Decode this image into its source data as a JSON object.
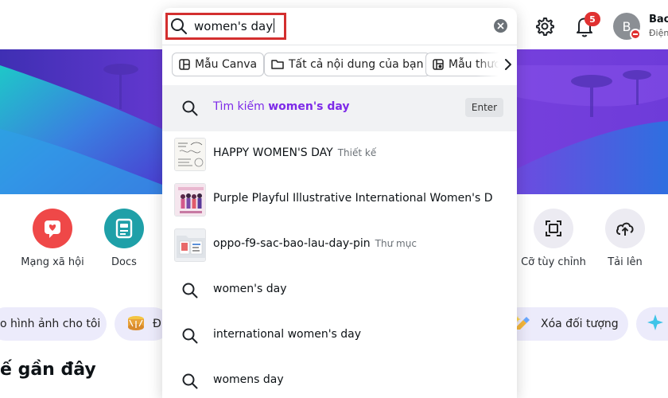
{
  "search": {
    "query": "women's day",
    "filters": [
      {
        "label": "Mẫu Canva",
        "icon": "template-icon"
      },
      {
        "label": "Tất cả nội dung của bạn",
        "icon": "folder-icon"
      },
      {
        "label": "Mẫu thươn",
        "icon": "brand-template-icon"
      }
    ],
    "enter_prefix": "Tìm kiếm",
    "enter_query": "women's day",
    "enter_key": "Enter",
    "results": [
      {
        "title": "HAPPY WOMEN'S DAY",
        "type": "Thiết kế"
      },
      {
        "title": "Purple Playful Illustrative International Women's D...",
        "type": ""
      },
      {
        "title": "oppo-f9-sac-bao-lau-day-pin",
        "type": "Thư mục"
      }
    ],
    "suggestions": [
      "women's day",
      "international women's day",
      "womens day"
    ]
  },
  "header": {
    "notification_count": "5",
    "avatar_initial": "B",
    "user_name": "Bao",
    "user_sub": "Điện"
  },
  "quick_actions": [
    {
      "label": "Mạng xã hội",
      "color": "#ef4848"
    },
    {
      "label": "Docs",
      "color": "#1fa0a8"
    },
    {
      "label": "Cỡ tùy chỉnh",
      "color": "#ecebf2"
    },
    {
      "label": "Tải lên",
      "color": "#ecebf2"
    }
  ],
  "chips": [
    {
      "label": "o hình ảnh cho tôi"
    },
    {
      "label": "Đ"
    },
    {
      "label": "Xóa đối tượng"
    }
  ],
  "section_title": "ế gần đây",
  "colors": {
    "accent": "#7d2ae8",
    "highlight_border": "#d32f2f",
    "badge": "#e03131"
  }
}
